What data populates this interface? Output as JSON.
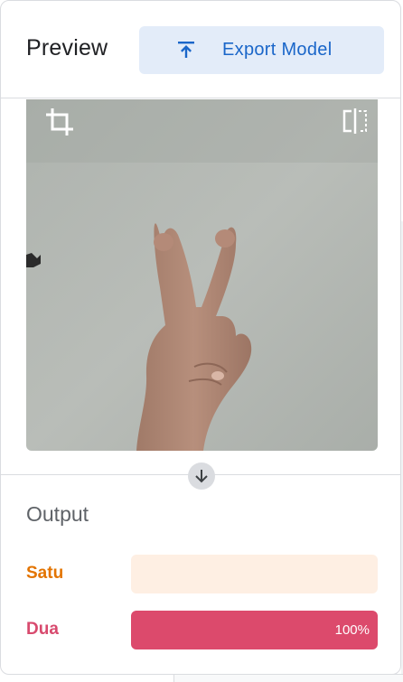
{
  "header": {
    "title": "Preview",
    "export_label": "Export Model"
  },
  "preview": {
    "crop_icon": "crop-icon",
    "flip_icon": "flip-horizontal-icon"
  },
  "output": {
    "title": "Output",
    "classes": [
      {
        "label": "Satu",
        "fraction": 0.0,
        "percent_text": "",
        "label_color": "#e37400",
        "track_color": "#feefe3",
        "fill_color": "#e37400"
      },
      {
        "label": "Dua",
        "fraction": 1.0,
        "percent_text": "100%",
        "label_color": "#d84a6e",
        "track_color": "#fce8ee",
        "fill_color": "#dc4a6c"
      }
    ]
  },
  "colors": {
    "accent": "#1a66c9",
    "export_bg": "#e3ecf9"
  }
}
